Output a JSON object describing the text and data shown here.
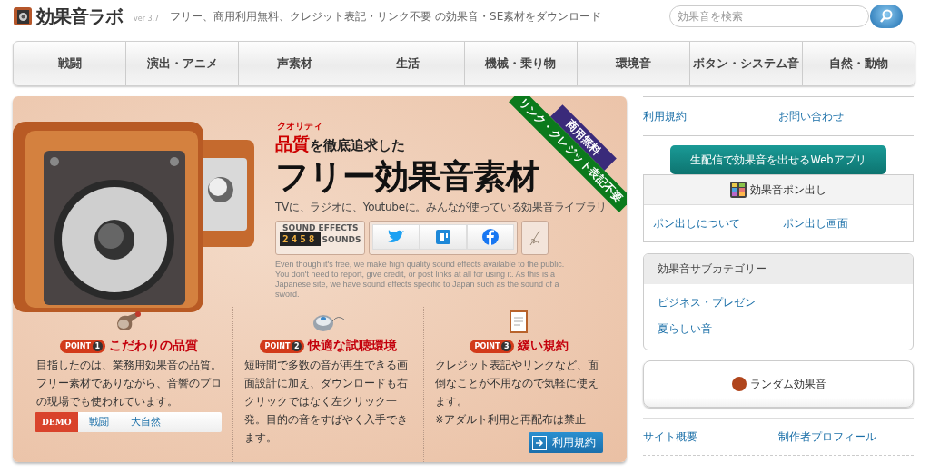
{
  "header": {
    "logo_text": "効果音ラボ",
    "version": "ver 3.7",
    "tagline": "フリー、商用利用無料、クレジット表記・リンク不要 の効果音・SE素材をダウンロード",
    "search": {
      "placeholder": "効果音を検索"
    }
  },
  "nav": [
    {
      "label": "戦闘"
    },
    {
      "label": "演出・アニメ"
    },
    {
      "label": "声素材"
    },
    {
      "label": "生活"
    },
    {
      "label": "機械・乗り物"
    },
    {
      "label": "環境音"
    },
    {
      "label": "ボタン・システム音"
    },
    {
      "label": "自然・動物"
    }
  ],
  "hero": {
    "ribbon_top": "商用無料",
    "ribbon_bottom": "リンク・クレジット表記不要",
    "ruby": "クオリティ",
    "headline_emphasis": "品質",
    "headline_rest": "を徹底追求した",
    "title": "フリー効果音素材",
    "subtitle": "TVに、ラジオに、Youtubeに。みんなが使っている効果音ライブラリ",
    "counter": {
      "label": "SOUND EFFECTS",
      "digits": "2458",
      "unit": "SOUNDS"
    },
    "description": "Even though it's free, we make high quality sound effects available to the public. You don't need to report, give credit, or post links at all for using it. As this is a Japanese site, we have sound effects specific to Japan such as the sound of a sword.",
    "points": [
      {
        "kind": "horn",
        "badge": "POINT",
        "number": "1",
        "title": "こだわりの品質",
        "text": "目指したのは、業務用効果音の品質。フリー素材でありながら、音響のプロの現場でも使われています。"
      },
      {
        "kind": "mouse",
        "badge": "POINT",
        "number": "2",
        "title": "快適な試聴環境",
        "text": "短時間で多数の音が再生できる画面設計に加え、ダウンロードも右クリックではなく左クリック一発。目的の音をすばやく入手できます。"
      },
      {
        "kind": "document",
        "badge": "POINT",
        "number": "3",
        "title": "緩い規約",
        "text": "クレジット表記やリンクなど、面倒なことが不用なので気軽に使えます。\n※アダルト利用と再配布は禁止"
      }
    ],
    "demo": {
      "label": "DEMO",
      "links": [
        "戦闘",
        "大自然"
      ]
    },
    "terms_button": "利用規約"
  },
  "sidebar": {
    "top_links": [
      "利用規約",
      "お問い合わせ"
    ],
    "app_banner": "生配信で効果音を出せるWebアプリ",
    "app_title": "効果音ポン出し",
    "app_links": [
      "ポン出しについて",
      "ポン出し画面"
    ],
    "subcategory": {
      "title": "効果音サブカテゴリー",
      "items": [
        "ビジネス・プレゼン",
        "夏らしい音"
      ]
    },
    "random": "ランダム効果音",
    "bottom_links": [
      "サイト概要",
      "制作者プロフィール"
    ]
  }
}
